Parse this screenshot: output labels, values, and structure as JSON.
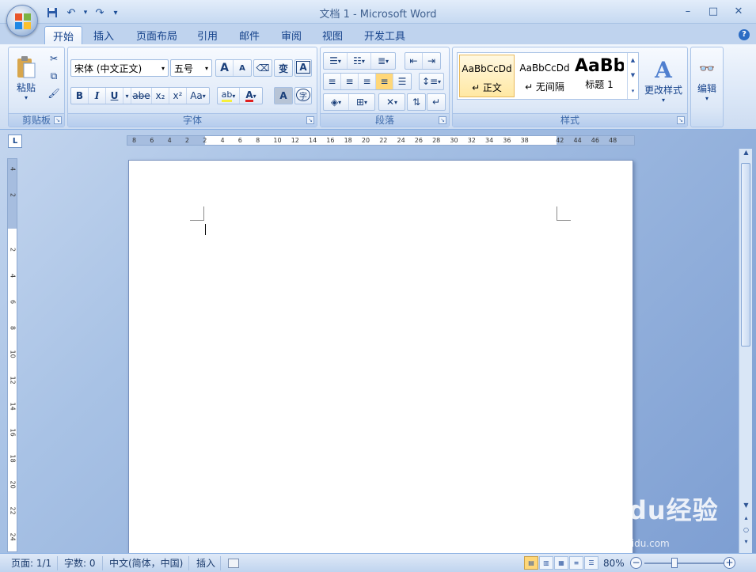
{
  "window": {
    "title": "文档 1 - Microsoft Word",
    "controls": [
      "–",
      "□",
      "✕"
    ]
  },
  "qat": {
    "save": "💾",
    "undo": "↶",
    "redo": "↷",
    "more": "▾"
  },
  "tabs": [
    {
      "label": "开始",
      "active": true
    },
    {
      "label": "插入"
    },
    {
      "label": "页面布局"
    },
    {
      "label": "引用"
    },
    {
      "label": "邮件"
    },
    {
      "label": "审阅"
    },
    {
      "label": "视图"
    },
    {
      "label": "开发工具"
    }
  ],
  "help": "?",
  "ribbon": {
    "clipboard": {
      "label": "剪贴板",
      "paste_label": "粘贴"
    },
    "font": {
      "label": "字体",
      "font_name": "宋体 (中文正文)",
      "font_size": "五号",
      "bold": "B",
      "italic": "I",
      "underline": "U",
      "strike": "abe",
      "subscript": "x₂",
      "superscript": "x²",
      "change_case": "Aa",
      "grow": "A",
      "shrink": "A",
      "phonetic": "变",
      "char_border": "A",
      "char_shading": "A",
      "enclose": "字"
    },
    "paragraph": {
      "label": "段落"
    },
    "styles": {
      "label": "样式",
      "items": [
        {
          "sample": "AaBbCcDd",
          "name": "↵ 正文",
          "selected": true
        },
        {
          "sample": "AaBbCcDd",
          "name": "↵ 无间隔"
        },
        {
          "sample": "AaBb",
          "name": "标题 1"
        }
      ],
      "change_styles": "更改样式"
    },
    "editing": {
      "label": "编辑"
    }
  },
  "ruler": {
    "corner": "L",
    "h_ticks": [
      "8",
      "6",
      "4",
      "2",
      "2",
      "4",
      "6",
      "8",
      "10",
      "12",
      "14",
      "16",
      "18",
      "20",
      "22",
      "24",
      "26",
      "28",
      "30",
      "32",
      "34",
      "36",
      "38",
      "42",
      "44",
      "46",
      "48"
    ],
    "v_ticks": [
      "4",
      "2",
      "2",
      "4",
      "6",
      "8",
      "10",
      "12",
      "14",
      "16",
      "18",
      "20",
      "22",
      "24"
    ]
  },
  "statusbar": {
    "page": "页面: 1/1",
    "words": "字数: 0",
    "language": "中文(简体，中国)",
    "mode": "插入",
    "zoom": "80%"
  },
  "watermark": {
    "main": "Baidu经验",
    "sub": "jingyan.baidu.com"
  }
}
